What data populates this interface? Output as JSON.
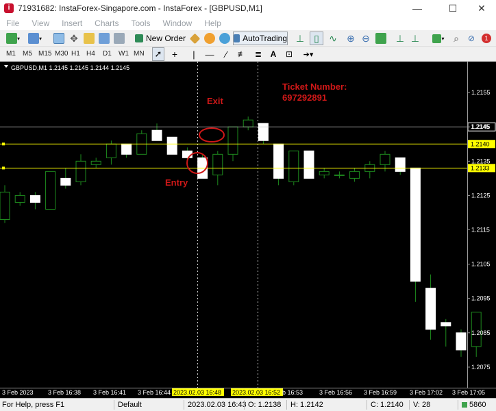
{
  "window": {
    "title": "71931682: InstaForex-Singapore.com - InstaForex - [GBPUSD,M1]",
    "minimize": "—",
    "maximize": "☐",
    "close": "✕"
  },
  "menu": [
    "File",
    "View",
    "Insert",
    "Charts",
    "Tools",
    "Window",
    "Help"
  ],
  "toolbar": {
    "new_order": "New Order",
    "autotrading": "AutoTrading",
    "notification_count": "1"
  },
  "timeframes": [
    "M1",
    "M5",
    "M15",
    "M30",
    "H1",
    "H4",
    "D1",
    "W1",
    "MN"
  ],
  "chart": {
    "header": "GBPUSD,M1  1.2145 1.2145 1.2144 1.2145",
    "annotations": {
      "exit": "Exit",
      "entry": "Entry",
      "ticket_line1": "Ticket Number:",
      "ticket_line2": "697292891"
    },
    "price_labels": [
      "1.2155",
      "1.2145",
      "1.2135",
      "1.2125",
      "1.2115",
      "1.2105",
      "1.2095",
      "1.2085",
      "1.2075"
    ],
    "hlines": [
      {
        "price": "1.2145",
        "style": "white"
      },
      {
        "price": "1.2140",
        "style": "yellow"
      },
      {
        "price": "1.2133",
        "style": "yellow"
      }
    ],
    "time_labels": [
      {
        "text": "3 Feb 2023",
        "hl": false
      },
      {
        "text": "3 Feb 16:38",
        "hl": false
      },
      {
        "text": "3 Feb 16:41",
        "hl": false
      },
      {
        "text": "3 Feb 16:44",
        "hl": false
      },
      {
        "text": "2023.02.03 16:48",
        "hl": true
      },
      {
        "text": "2023.02.03 16:52",
        "hl": true
      },
      {
        "text": "b 16:53",
        "hl": false
      },
      {
        "text": "3 Feb 16:56",
        "hl": false
      },
      {
        "text": "3 Feb 16:59",
        "hl": false
      },
      {
        "text": "3 Feb 17:02",
        "hl": false
      },
      {
        "text": "3 Feb 17:05",
        "hl": false
      }
    ]
  },
  "chart_data": {
    "type": "candlestick",
    "symbol": "GBPUSD",
    "timeframe": "M1",
    "ylim": [
      1.2069,
      1.2164
    ],
    "candles": [
      {
        "o": 1.2118,
        "h": 1.2128,
        "l": 1.2117,
        "c": 1.2126
      },
      {
        "o": 1.2123,
        "h": 1.2126,
        "l": 1.2122,
        "c": 1.2125
      },
      {
        "o": 1.2125,
        "h": 1.2126,
        "l": 1.2121,
        "c": 1.2123
      },
      {
        "o": 1.2121,
        "h": 1.2132,
        "l": 1.2121,
        "c": 1.2132
      },
      {
        "o": 1.213,
        "h": 1.2133,
        "l": 1.2127,
        "c": 1.2128
      },
      {
        "o": 1.2129,
        "h": 1.2137,
        "l": 1.2128,
        "c": 1.2135
      },
      {
        "o": 1.2134,
        "h": 1.2136,
        "l": 1.2133,
        "c": 1.2135
      },
      {
        "o": 1.2136,
        "h": 1.2141,
        "l": 1.2134,
        "c": 1.214
      },
      {
        "o": 1.214,
        "h": 1.214,
        "l": 1.2136,
        "c": 1.2137
      },
      {
        "o": 1.2137,
        "h": 1.2144,
        "l": 1.2137,
        "c": 1.2143
      },
      {
        "o": 1.2144,
        "h": 1.2146,
        "l": 1.2141,
        "c": 1.2141
      },
      {
        "o": 1.2142,
        "h": 1.2142,
        "l": 1.2137,
        "c": 1.2137
      },
      {
        "o": 1.2138,
        "h": 1.2139,
        "l": 1.2134,
        "c": 1.2136
      },
      {
        "o": 1.2136,
        "h": 1.2137,
        "l": 1.213,
        "c": 1.213
      },
      {
        "o": 1.2131,
        "h": 1.2138,
        "l": 1.2128,
        "c": 1.2137
      },
      {
        "o": 1.2137,
        "h": 1.2145,
        "l": 1.2135,
        "c": 1.2145
      },
      {
        "o": 1.2145,
        "h": 1.2148,
        "l": 1.2144,
        "c": 1.2147
      },
      {
        "o": 1.2146,
        "h": 1.2146,
        "l": 1.214,
        "c": 1.2141
      },
      {
        "o": 1.214,
        "h": 1.214,
        "l": 1.2128,
        "c": 1.213
      },
      {
        "o": 1.2129,
        "h": 1.2138,
        "l": 1.2128,
        "c": 1.2138
      },
      {
        "o": 1.2138,
        "h": 1.2138,
        "l": 1.213,
        "c": 1.213
      },
      {
        "o": 1.2131,
        "h": 1.2133,
        "l": 1.213,
        "c": 1.2132
      },
      {
        "o": 1.2131,
        "h": 1.2132,
        "l": 1.213,
        "c": 1.2131
      },
      {
        "o": 1.213,
        "h": 1.2133,
        "l": 1.2129,
        "c": 1.2132
      },
      {
        "o": 1.2132,
        "h": 1.2135,
        "l": 1.213,
        "c": 1.2134
      },
      {
        "o": 1.2134,
        "h": 1.2138,
        "l": 1.2132,
        "c": 1.2137
      },
      {
        "o": 1.2136,
        "h": 1.2136,
        "l": 1.2131,
        "c": 1.2132
      },
      {
        "o": 1.2133,
        "h": 1.2133,
        "l": 1.2094,
        "c": 1.21
      },
      {
        "o": 1.2098,
        "h": 1.2102,
        "l": 1.2083,
        "c": 1.2086
      },
      {
        "o": 1.2088,
        "h": 1.2089,
        "l": 1.2081,
        "c": 1.2087
      },
      {
        "o": 1.2085,
        "h": 1.2086,
        "l": 1.2078,
        "c": 1.208
      },
      {
        "o": 1.2081,
        "h": 1.2091,
        "l": 1.2078,
        "c": 1.2091
      }
    ]
  },
  "status": {
    "help": "For Help, press F1",
    "profile": "Default",
    "time": "2023.02.03 16:43",
    "open": "O: 1.2138",
    "high": "H: 1.2142",
    "close": "C: 1.2140",
    "volume": "V: 28",
    "traffic": "5860"
  },
  "colors": {
    "bull_body": "#000000",
    "bear_body": "#ffffff",
    "wick": "#1e8c1e",
    "annotation": "#d01818",
    "marker_line": "#ffff00",
    "background": "#000000"
  }
}
